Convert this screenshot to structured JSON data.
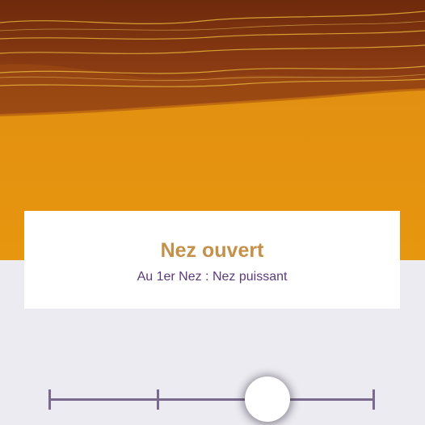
{
  "colors": {
    "accent": "#c3914a",
    "subtitle": "#5b3b7b",
    "header_dark": "#7a3210",
    "header_orange": "#e39112",
    "panel": "#ecebf1",
    "slider": "#7a6a8d"
  },
  "card": {
    "title": "Nez ouvert",
    "subtitle": "Au 1er Nez : Nez puissant"
  },
  "slider": {
    "stops": 3,
    "value_fraction": 0.67
  }
}
